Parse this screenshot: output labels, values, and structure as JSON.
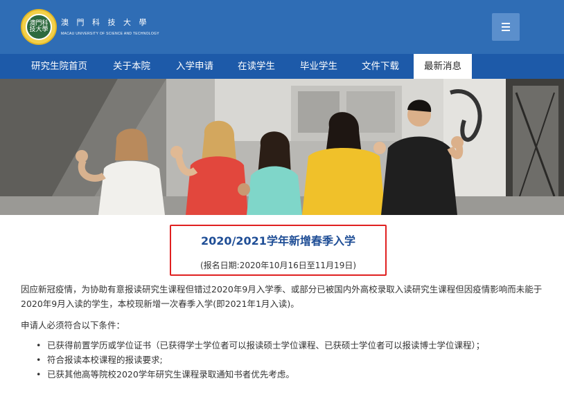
{
  "header": {
    "logo_text": "澳門科技大學",
    "brand_cn": "澳 門 科 技 大 學",
    "brand_en": "MACAU UNIVERSITY OF SCIENCE AND TECHNOLOGY",
    "menu_icon": "hamburger-menu-icon",
    "bg_color": "#2f6db5"
  },
  "nav": {
    "items": [
      {
        "label": "研究生院首页"
      },
      {
        "label": "关于本院"
      },
      {
        "label": "入学申请"
      },
      {
        "label": "在读学生"
      },
      {
        "label": "毕业学生"
      },
      {
        "label": "文件下载"
      },
      {
        "label": "最新消息",
        "active": true
      }
    ],
    "bg_color": "#1d5aa9"
  },
  "banner": {
    "description_icon": "students-waving-photo"
  },
  "notice": {
    "title": "2020/2021学年新增春季入学",
    "date": "(报名日期:2020年10月16日至11月19日)",
    "highlight_color": "#e02020"
  },
  "content": {
    "intro": "因应新冠疫情，为协助有意报读研究生课程但错过2020年9月入学季、或部分已被国内外高校录取入读研究生课程但因疫情影响而未能于2020年9月入读的学生，本校现新增一次春季入学(即2021年1月入读)。",
    "requirements_heading": "申请人必须符合以下条件：",
    "requirements": [
      "已获得前置学历或学位证书（已获得学士学位者可以报读硕士学位课程、已获硕士学位者可以报读博士学位课程）；",
      "符合报读本校课程的报读要求;",
      "已获其他高等院校2020学年研究生课程录取通知书者优先考虑。"
    ]
  }
}
